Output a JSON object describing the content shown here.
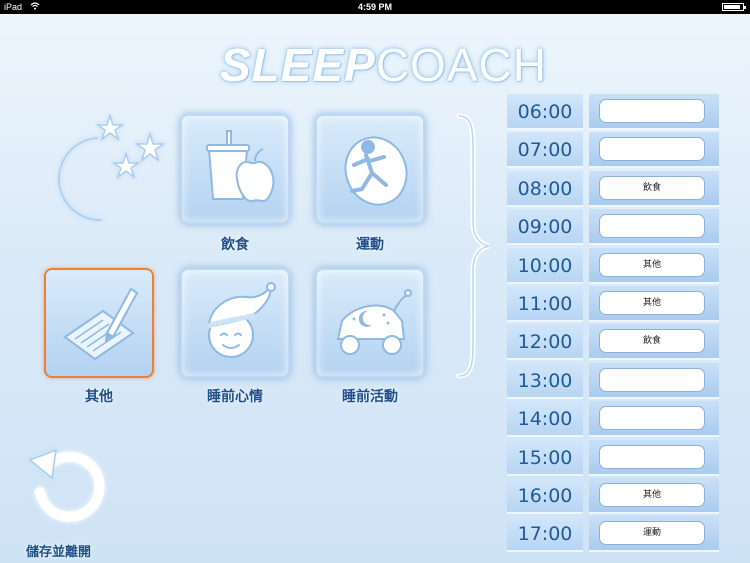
{
  "status_bar": {
    "device": "iPad",
    "time": "4:59 PM",
    "battery_level": 0.9
  },
  "title": {
    "bold": "SLEEP",
    "light": "COACH"
  },
  "categories": [
    {
      "label": "飲食",
      "icon": "food-drink-icon"
    },
    {
      "label": "運動",
      "icon": "exercise-icon"
    },
    {
      "label": "其他",
      "icon": "note-pencil-icon",
      "selected": true
    },
    {
      "label": "睡前心情",
      "icon": "sleep-mood-icon"
    },
    {
      "label": "睡前活動",
      "icon": "bedtime-activity-icon"
    }
  ],
  "save_exit": {
    "label": "儲存並離開",
    "icon": "undo-arrow-icon"
  },
  "schedule": [
    {
      "time": "06:00",
      "entry": ""
    },
    {
      "time": "07:00",
      "entry": ""
    },
    {
      "time": "08:00",
      "entry": "飲食"
    },
    {
      "time": "09:00",
      "entry": ""
    },
    {
      "time": "10:00",
      "entry": "其他"
    },
    {
      "time": "11:00",
      "entry": "其他"
    },
    {
      "time": "12:00",
      "entry": "飲食"
    },
    {
      "time": "13:00",
      "entry": ""
    },
    {
      "time": "14:00",
      "entry": ""
    },
    {
      "time": "15:00",
      "entry": ""
    },
    {
      "time": "16:00",
      "entry": "其他"
    },
    {
      "time": "17:00",
      "entry": "運動"
    }
  ],
  "colors": {
    "label_blue": "#1e4f88",
    "selected_border": "#e8823a",
    "time_text": "#1f5a99"
  }
}
